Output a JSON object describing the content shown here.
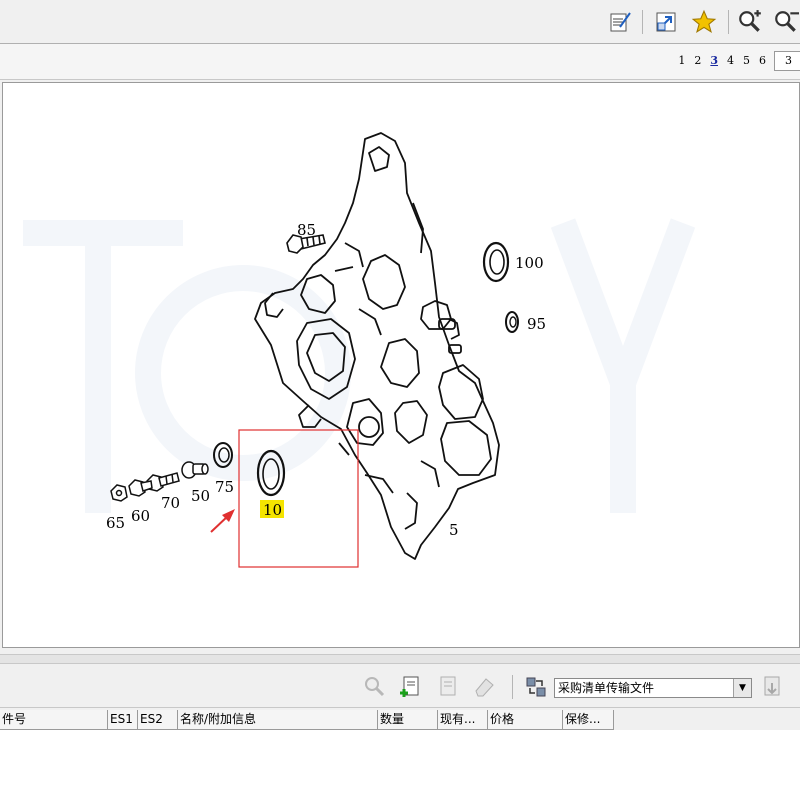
{
  "toolbar": {
    "icons": [
      "edit-note-icon",
      "resize-icon",
      "favorite-star-icon",
      "zoom-in-icon",
      "zoom-out-icon"
    ]
  },
  "pager": {
    "pages": [
      "1",
      "2",
      "3",
      "4",
      "5",
      "6"
    ],
    "current": "3",
    "input_value": "3"
  },
  "diagram": {
    "labels": {
      "p5": "5",
      "p10": "10",
      "p50": "50",
      "p60": "60",
      "p65": "65",
      "p70": "70",
      "p75": "75",
      "p85": "85",
      "p95": "95",
      "p100": "100"
    },
    "highlight_color": "#f5e400",
    "box_color": "#e03030",
    "arrow_color": "#e03030"
  },
  "bottom_toolbar": {
    "transfer_select_value": "采购清单传输文件"
  },
  "table": {
    "columns": [
      "件号",
      "ES1",
      "ES2",
      "名称/附加信息",
      "数量",
      "现有...",
      "价格",
      "保修..."
    ]
  }
}
